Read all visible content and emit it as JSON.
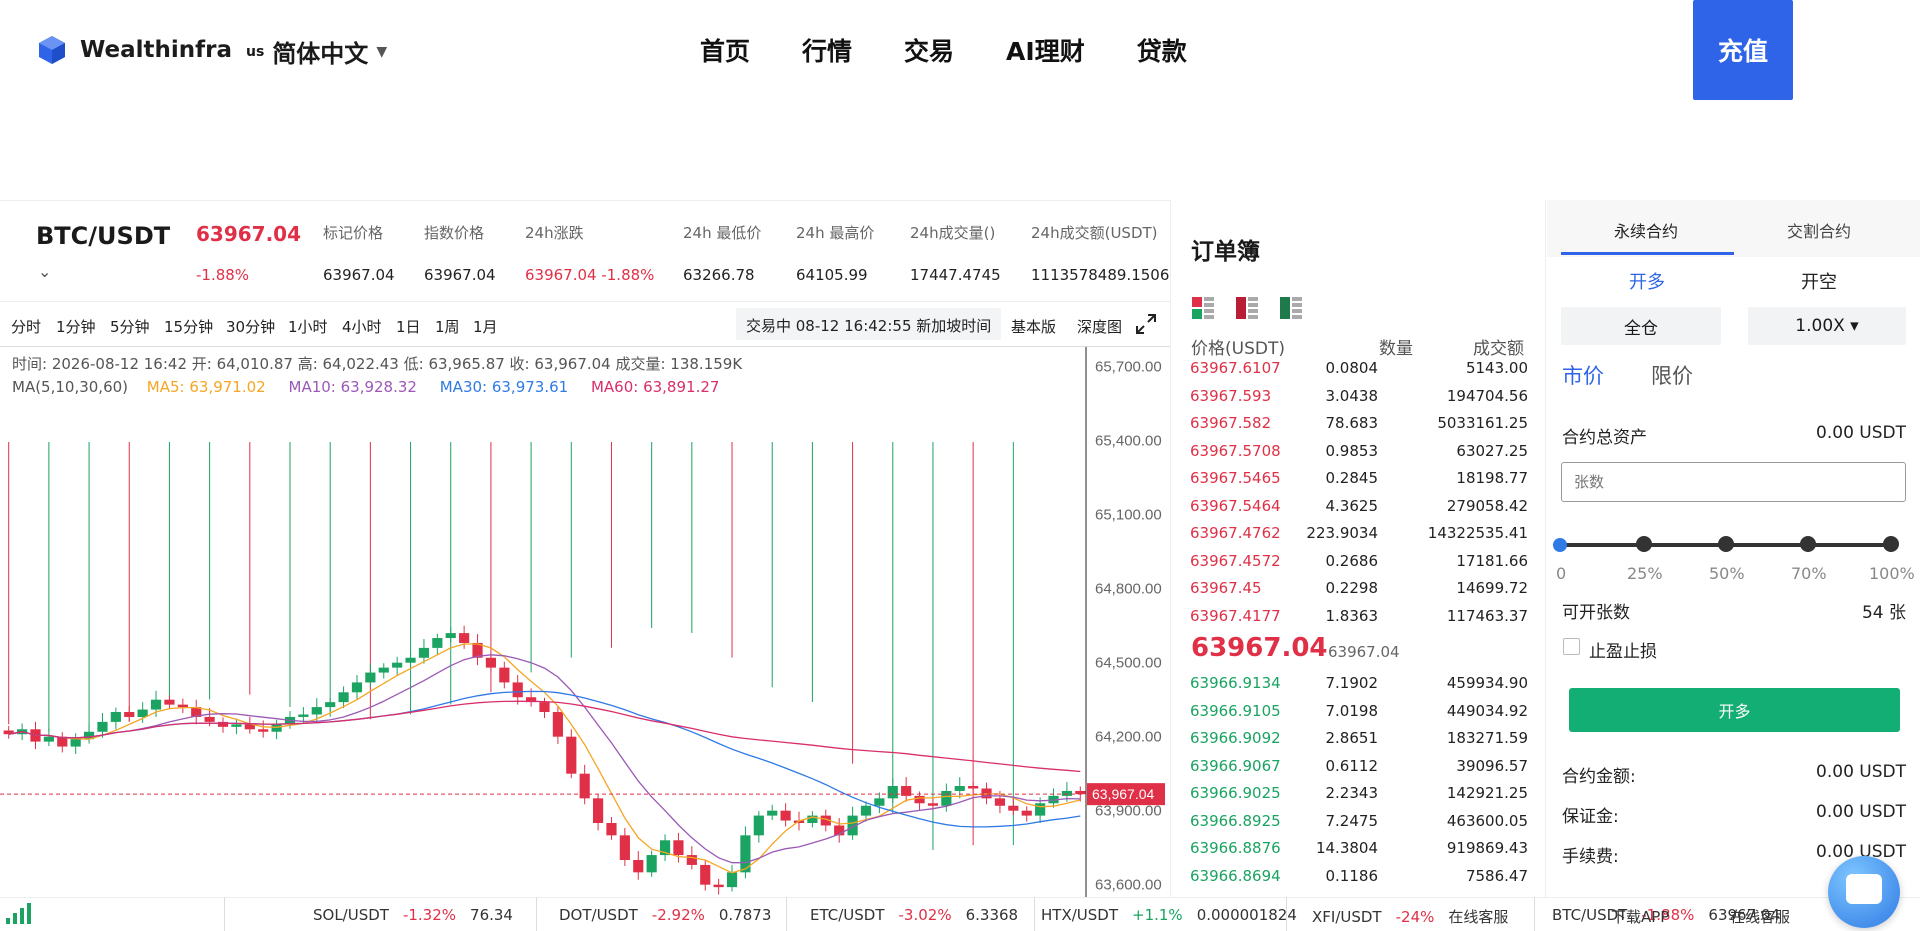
{
  "header": {
    "brand": "Wealthinfra",
    "lang_flag": "us",
    "lang_label": "简体中文",
    "nav": [
      "首页",
      "行情",
      "交易",
      "AI理财",
      "贷款"
    ],
    "menu_icon": "☰",
    "deposit_label": "充值",
    "accent": "#2f64e8"
  },
  "ticker": {
    "pair": "BTC/USDT",
    "last_price": "63967.04",
    "change_pct": "-1.88%",
    "stats": [
      {
        "label": "标记价格",
        "value": "63967.04"
      },
      {
        "label": "指数价格",
        "value": "63967.04"
      },
      {
        "label": "24h涨跌",
        "value": "63967.04  -1.88%"
      },
      {
        "label": "24h 最低价",
        "value": "63266.78"
      },
      {
        "label": "24h 最高价",
        "value": "64105.99"
      },
      {
        "label": "24h成交量()",
        "value": "17447.4745"
      },
      {
        "label": "24h成交额(USDT)",
        "value": "1113578489.1506"
      }
    ]
  },
  "timeframes": [
    "分时",
    "1分钟",
    "5分钟",
    "15分钟",
    "30分钟",
    "1小时",
    "4小时",
    "1日",
    "1周",
    "1月"
  ],
  "chart_toolbar": {
    "session": "交易中 08-12 16:42:55  新加坡时间",
    "basic": "基本版",
    "depth": "深度图"
  },
  "chart_info": {
    "line": "时间:  2026-08-12 16:42     开:  64,010.87      高:  64,022.43      低:  63,965.87      收:  63,967.04      成交量:  138.159K",
    "ma_label": "MA(5,10,30,60)",
    "ma5": "MA5: 63,971.02",
    "ma10": "MA10: 63,928.32",
    "ma30": "MA30: 63,973.61",
    "ma60": "MA60: 63,891.27"
  },
  "chart_data": {
    "type": "candlestick",
    "y_ticks": [
      "65,700.00",
      "65,400.00",
      "65,100.00",
      "64,800.00",
      "64,500.00",
      "64,200.00",
      "63,900.00",
      "63,600.00"
    ],
    "ylim": [
      63550,
      65780
    ],
    "current_price_label": "63,967.04",
    "current_price": 63967.04,
    "closes": [
      64210,
      64230,
      64180,
      64200,
      64160,
      64190,
      64220,
      64260,
      64300,
      64280,
      64310,
      64350,
      64330,
      64320,
      64280,
      64260,
      64240,
      64250,
      64230,
      64220,
      64250,
      64280,
      64290,
      64320,
      64340,
      64380,
      64420,
      64460,
      64480,
      64500,
      64520,
      64560,
      64600,
      64620,
      64580,
      64520,
      64480,
      64420,
      64360,
      64340,
      64300,
      64200,
      64050,
      63950,
      63850,
      63800,
      63700,
      63650,
      63720,
      63780,
      63720,
      63680,
      63600,
      63590,
      63650,
      63800,
      63880,
      63900,
      63860,
      63850,
      63880,
      63840,
      63800,
      63880,
      63920,
      63950,
      64000,
      63960,
      63930,
      63920,
      63980,
      64000,
      63990,
      63950,
      63920,
      63900,
      63880,
      63930,
      63960,
      63980,
      63967
    ],
    "ma5_color": "#f5a623",
    "ma10_color": "#9b59b6",
    "ma30_color": "#2f7ae5",
    "ma60_color": "#d92e6b"
  },
  "orderbook": {
    "title": "订单簿",
    "headers": [
      "价格(USDT)",
      "数量",
      "成交额"
    ],
    "asks": [
      [
        "63967.6107",
        "0.0804",
        "5143.00"
      ],
      [
        "63967.593",
        "3.0438",
        "194704.56"
      ],
      [
        "63967.582",
        "78.683",
        "5033161.25"
      ],
      [
        "63967.5708",
        "0.9853",
        "63027.25"
      ],
      [
        "63967.5465",
        "0.2845",
        "18198.77"
      ],
      [
        "63967.5464",
        "4.3625",
        "279058.42"
      ],
      [
        "63967.4762",
        "223.9034",
        "14322535.41"
      ],
      [
        "63967.4572",
        "0.2686",
        "17181.66"
      ],
      [
        "63967.45",
        "0.2298",
        "14699.72"
      ],
      [
        "63967.4177",
        "1.8363",
        "117463.37"
      ]
    ],
    "mid_price": "63967.04",
    "mid_sub": "63967.04",
    "bids": [
      [
        "63966.9134",
        "7.1902",
        "459934.90"
      ],
      [
        "63966.9105",
        "7.0198",
        "449034.92"
      ],
      [
        "63966.9092",
        "2.8651",
        "183271.59"
      ],
      [
        "63966.9067",
        "0.6112",
        "39096.57"
      ],
      [
        "63966.9025",
        "2.2343",
        "142921.25"
      ],
      [
        "63966.8925",
        "7.2475",
        "463600.05"
      ],
      [
        "63966.8876",
        "14.3804",
        "919869.43"
      ],
      [
        "63966.8694",
        "0.1186",
        "7586.47"
      ]
    ]
  },
  "trade": {
    "tabs": [
      "永续合约",
      "交割合约"
    ],
    "sides": [
      "开多",
      "开空"
    ],
    "margin_mode": "全仓",
    "leverage": "1.00X ▾",
    "order_types": [
      "市价",
      "限价"
    ],
    "assets_label": "合约总资产",
    "assets_value": "0.00 USDT",
    "qty_placeholder": "张数",
    "slider_marks": [
      "0",
      "25%",
      "50%",
      "70%",
      "100%"
    ],
    "openable_label": "可开张数",
    "openable_value": "54 张",
    "tpsl_label": "止盈止损",
    "open_btn": "开多",
    "amount_label": "合约金额:",
    "amount_value": "0.00 USDT",
    "margin_label": "保证金:",
    "margin_value": "0.00 USDT",
    "fee_label": "手续费:",
    "fee_value": "0.00 USDT"
  },
  "bottom_tickers": [
    {
      "pair": "SOL/USDT",
      "pct": "-1.32%",
      "price": "76.34"
    },
    {
      "pair": "DOT/USDT",
      "pct": "-2.92%",
      "price": "0.7873"
    },
    {
      "pair": "ETC/USDT",
      "pct": "-3.02%",
      "price": "6.3368"
    },
    {
      "pair": "HTX/USDT",
      "pct": "+1.1%",
      "price": "0.000001824"
    },
    {
      "pair": "XFI/USDT",
      "pct": "-24%",
      "price": "在线客服"
    },
    {
      "pair": "BTC/USDT",
      "pct": "-1.88%",
      "price": "63967.04"
    }
  ],
  "bottom_extra": {
    "app": "下载APP",
    "service": "在线客服"
  }
}
